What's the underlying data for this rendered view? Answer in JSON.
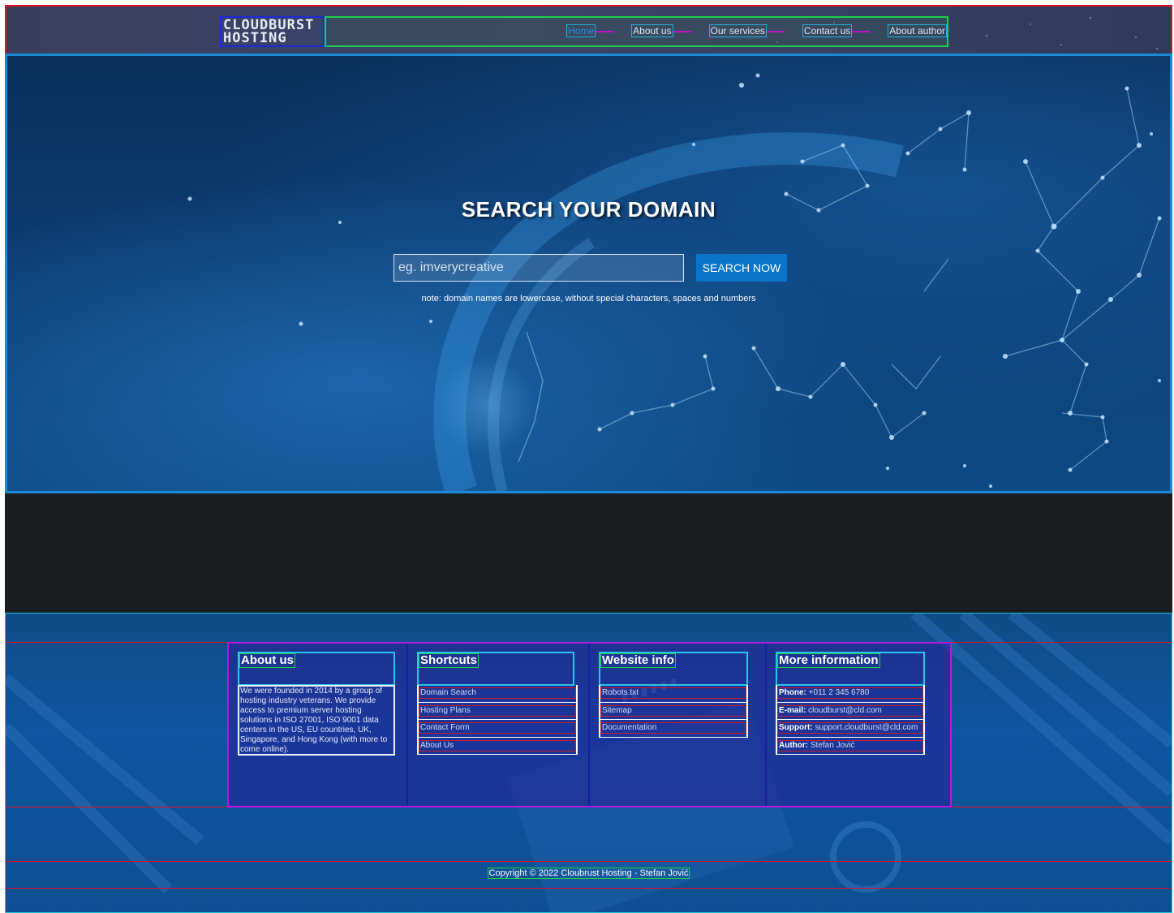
{
  "header": {
    "logo_line1": "CLOUDBURST",
    "logo_line2": "HOSTING",
    "nav": [
      {
        "label": "Home",
        "active": true
      },
      {
        "label": "About us"
      },
      {
        "label": "Our services"
      },
      {
        "label": "Contact us"
      },
      {
        "label": "About author"
      }
    ]
  },
  "hero": {
    "title": "SEARCH YOUR DOMAIN",
    "input_placeholder": "eg. imverycreative",
    "button_label": "SEARCH NOW",
    "note": "note: domain names are lowercase, without special characters, spaces and numbers"
  },
  "footer": {
    "about": {
      "title": "About us",
      "text": "We were founded in 2014 by a group of hosting industry veterans. We provide access to premium server hosting solutions in ISO 27001, ISO 9001 data centers in the US, EU countries, UK, Singapore, and Hong Kong (with more to come online)."
    },
    "shortcuts": {
      "title": "Shortcuts",
      "links": [
        "Domain Search",
        "Hosting Plans",
        "Contact Form",
        "About Us"
      ]
    },
    "website_info": {
      "title": "Website info",
      "links": [
        "Robots.txt",
        "Sitemap",
        "Documentation"
      ]
    },
    "more_info": {
      "title": "More information",
      "items": [
        {
          "label": "Phone:",
          "value": "+011 2 345 6780"
        },
        {
          "label": "E-mail:",
          "value": "cloudburst@cld.com"
        },
        {
          "label": "Support:",
          "value": "support.cloudburst@cld.com"
        },
        {
          "label": "Author:",
          "value": "Stefan Jović"
        }
      ]
    },
    "copyright": "Copyright © 2022 Cloubrust Hosting - Stefan Jović"
  },
  "colors": {
    "accent": "#0a74c8",
    "header_bg": "#3a4266",
    "hero_bg": "#0c3b70",
    "dark_band": "#1b1c1f",
    "footer_columns_bg": "#2a2496"
  }
}
